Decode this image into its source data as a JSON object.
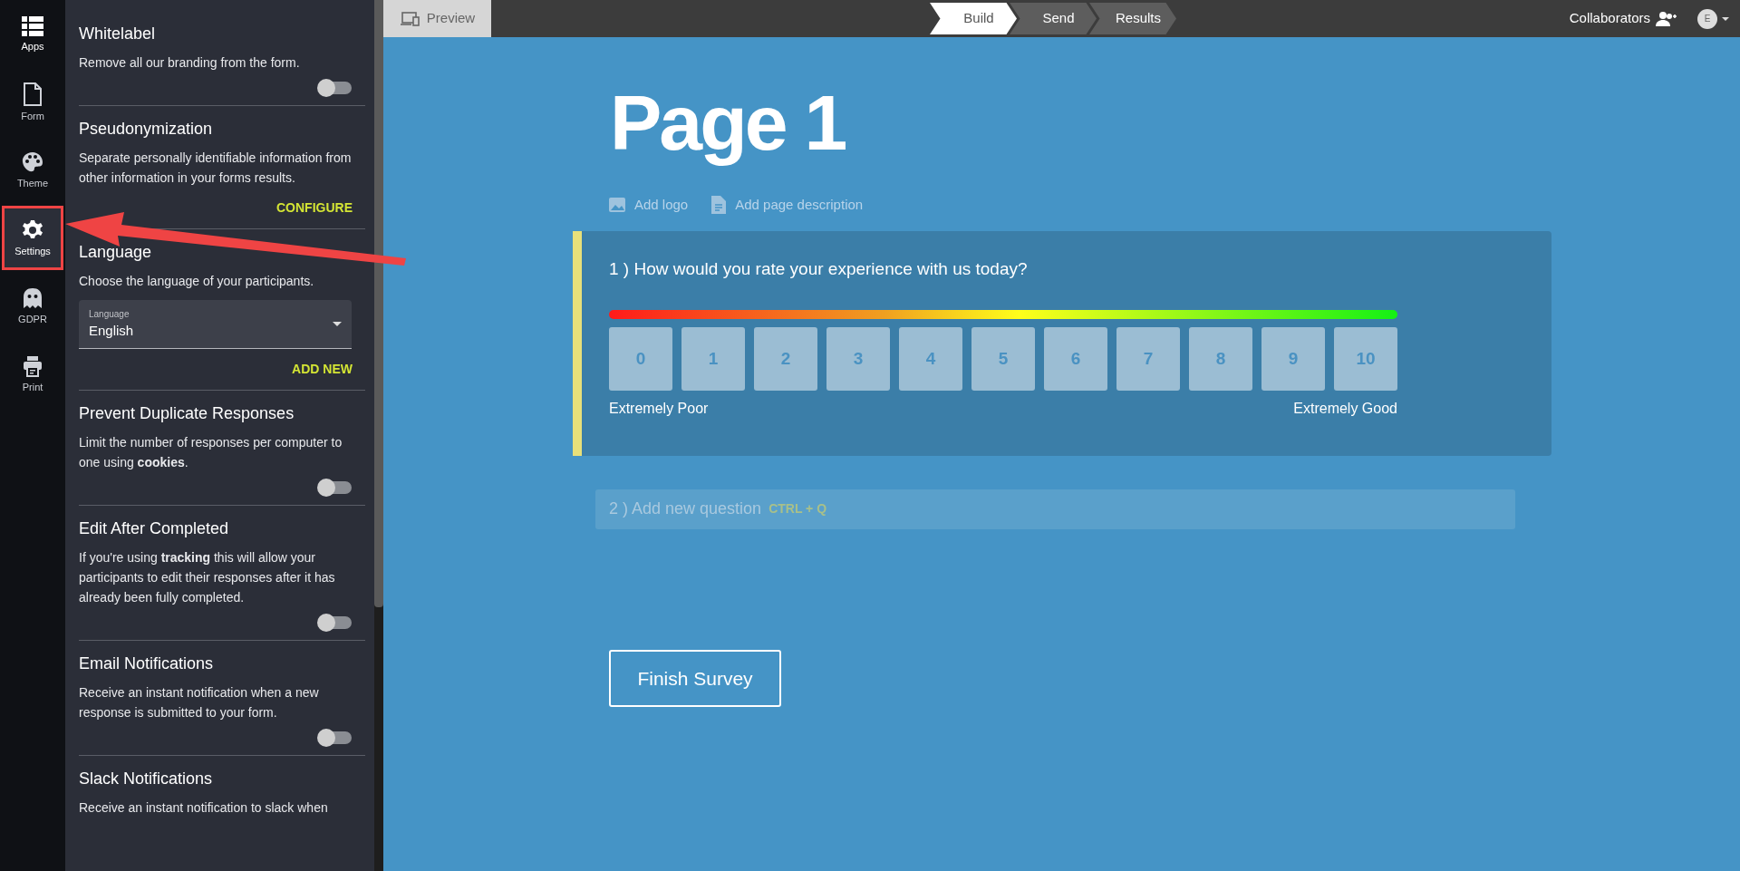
{
  "nav": [
    {
      "label": "Apps",
      "selected": false
    },
    {
      "label": "Form",
      "selected": false
    },
    {
      "label": "Theme",
      "selected": false
    },
    {
      "label": "Settings",
      "selected": true
    },
    {
      "label": "GDPR",
      "selected": false
    },
    {
      "label": "Print",
      "selected": false
    }
  ],
  "settings": [
    {
      "title": "Whitelabel",
      "description": "Remove all our branding from the form.",
      "controls": [
        {
          "kind": "toggle",
          "on": false
        }
      ]
    },
    {
      "title": "Pseudonymization",
      "description": "Separate personally identifiable information from other information in your forms results.",
      "controls": [
        {
          "kind": "link",
          "label": "CONFIGURE"
        }
      ]
    },
    {
      "title": "Language",
      "description": "Choose the language of your participants.",
      "controls": [
        {
          "kind": "select",
          "label": "Language",
          "value": "English"
        },
        {
          "kind": "link",
          "label": "ADD NEW"
        }
      ]
    },
    {
      "title": "Prevent Duplicate Responses",
      "description": "Limit the number of responses per computer to one using **cookies**.",
      "controls": [
        {
          "kind": "toggle",
          "on": false
        }
      ]
    },
    {
      "title": "Edit After Completed",
      "description": "If you're using **tracking** this will allow your participants to edit their responses after it has already been fully completed.",
      "controls": [
        {
          "kind": "toggle",
          "on": false
        }
      ]
    },
    {
      "title": "Email Notifications",
      "description": "Receive an instant notification when a new response is submitted to your form.",
      "controls": [
        {
          "kind": "toggle",
          "on": false
        }
      ]
    },
    {
      "title": "Slack Notifications",
      "description": "Receive an instant notification to slack when"
    }
  ],
  "top_bar": {
    "preview": "Preview",
    "steps": [
      {
        "label": "Build",
        "selected": true
      },
      {
        "label": "Send",
        "selected": false
      },
      {
        "label": "Results",
        "selected": false
      }
    ],
    "collaborators": "Collaborators",
    "avatar": "E"
  },
  "page": {
    "title": "Page 1",
    "actions": [
      "Add logo",
      "Add page description"
    ],
    "questions": [
      {
        "number": "1 )",
        "text": "How would you rate your experience with us today?",
        "scale": [
          "0",
          "1",
          "2",
          "3",
          "4",
          "5",
          "6",
          "7",
          "8",
          "9",
          "10"
        ],
        "low_label": "Extremely Poor",
        "high_label": "Extremely Good"
      }
    ],
    "new_question": {
      "number": "2 )",
      "placeholder": "Add new question",
      "shortcut": "CTRL + Q"
    },
    "finish_button": "Finish Survey"
  }
}
